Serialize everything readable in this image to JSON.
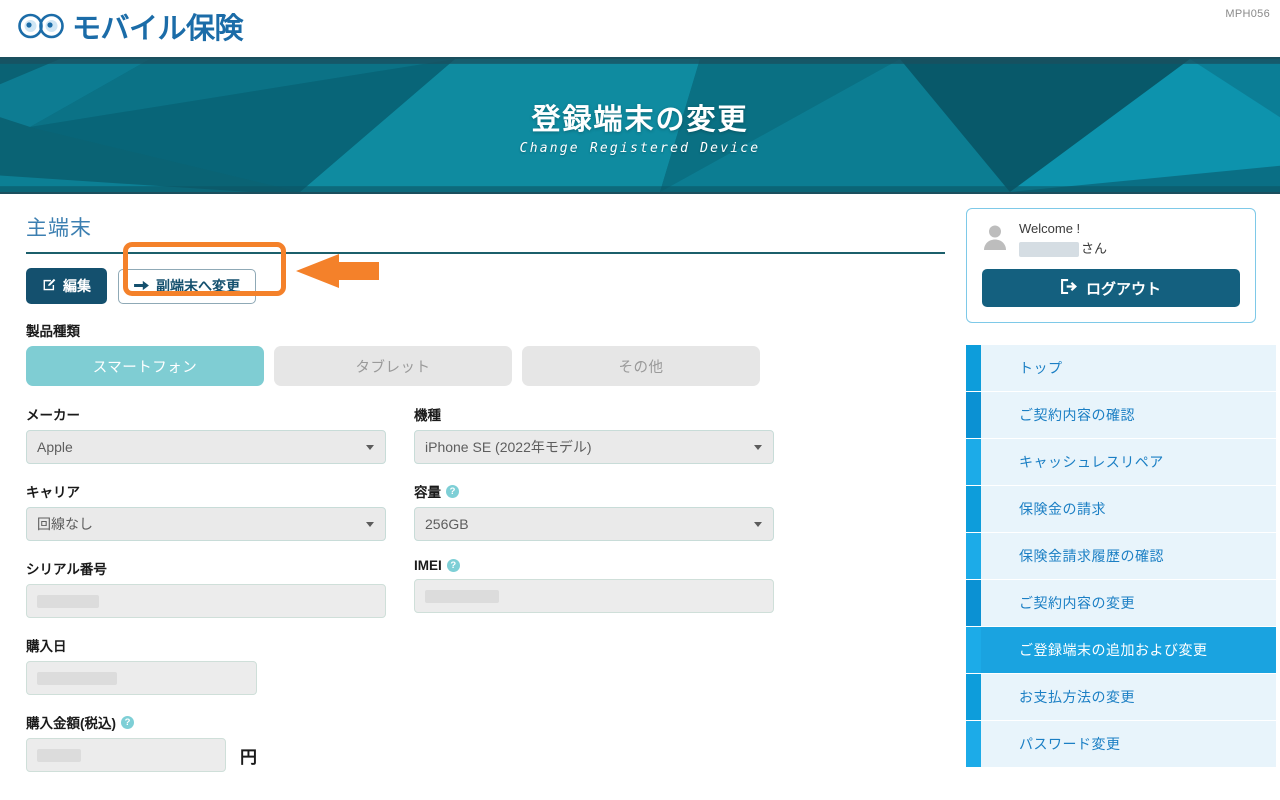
{
  "header": {
    "logo_text": "モバイル保険",
    "logo_icon": "infinity-glasses-logo",
    "page_code": "MPH056"
  },
  "banner": {
    "title": "登録端末の変更",
    "subtitle": "Change Registered Device",
    "bg_color": "#0a6a7d"
  },
  "main": {
    "section_title": "主端末",
    "actions": {
      "edit_label": "編集",
      "edit_icon": "pencil-square-icon",
      "switch_label": "副端末へ変更",
      "switch_icon": "arrow-right-icon"
    },
    "annotation": {
      "color": "#f4812a",
      "shape": "rounded-rect-with-left-arrow"
    },
    "product_type": {
      "label": "製品種類",
      "options": [
        {
          "label": "スマートフォン",
          "selected": true
        },
        {
          "label": "タブレット",
          "selected": false
        },
        {
          "label": "その他",
          "selected": false
        }
      ],
      "selected_color": "#7fcdd3"
    },
    "fields": {
      "maker": {
        "label": "メーカー",
        "value": "Apple",
        "type": "select"
      },
      "model": {
        "label": "機種",
        "value": "iPhone SE (2022年モデル)",
        "type": "select"
      },
      "carrier": {
        "label": "キャリア",
        "value": "回線なし",
        "type": "select"
      },
      "capacity": {
        "label": "容量",
        "value": "256GB",
        "type": "select",
        "help": "?"
      },
      "serial": {
        "label": "シリアル番号",
        "value": "",
        "type": "text",
        "masked": true
      },
      "imei": {
        "label": "IMEI",
        "value": "",
        "type": "text",
        "masked": true,
        "help": "?"
      },
      "purchase_date": {
        "label": "購入日",
        "value": "",
        "type": "text",
        "masked": true
      },
      "purchase_amount": {
        "label": "購入金額(税込)",
        "value": "",
        "type": "text",
        "masked": true,
        "help": "?",
        "unit": "円"
      }
    }
  },
  "sidebar": {
    "welcome": {
      "greeting": "Welcome !",
      "name_masked": true,
      "name_suffix": "さん",
      "avatar_icon": "user-avatar-icon",
      "logout_label": "ログアウト",
      "logout_icon": "logout-arrow-icon"
    },
    "nav_items": [
      {
        "label": "トップ",
        "active": false
      },
      {
        "label": "ご契約内容の確認",
        "active": false
      },
      {
        "label": "キャッシュレスリペア",
        "active": false
      },
      {
        "label": "保険金の請求",
        "active": false
      },
      {
        "label": "保険金請求履歴の確認",
        "active": false
      },
      {
        "label": "ご契約内容の変更",
        "active": false
      },
      {
        "label": "ご登録端末の追加および変更",
        "active": true
      },
      {
        "label": "お支払方法の変更",
        "active": false
      },
      {
        "label": "パスワード変更",
        "active": false
      }
    ]
  }
}
